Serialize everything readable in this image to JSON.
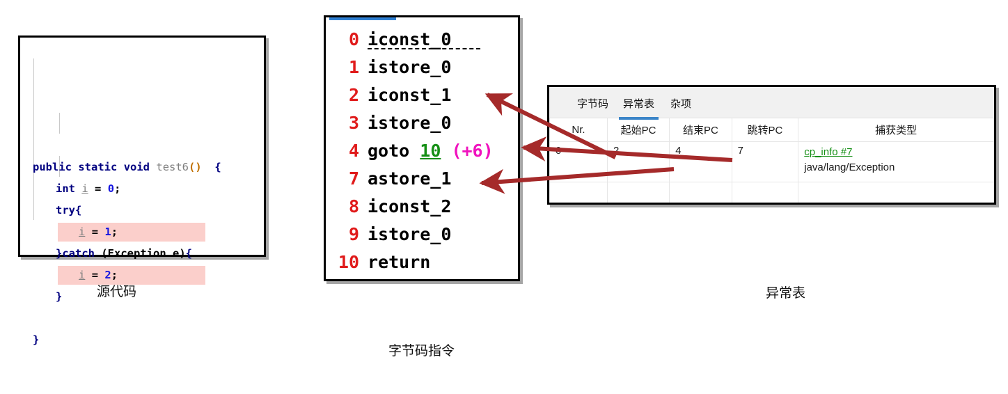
{
  "source_panel": {
    "title": "source-code",
    "lines": [
      {
        "indent": 0,
        "highlight": false,
        "tokens": [
          {
            "t": "public",
            "c": "k"
          },
          {
            "t": " ",
            "c": "plain"
          },
          {
            "t": "static",
            "c": "k"
          },
          {
            "t": " ",
            "c": "plain"
          },
          {
            "t": "void",
            "c": "k"
          },
          {
            "t": " ",
            "c": "plain"
          },
          {
            "t": "test6",
            "c": "mth"
          },
          {
            "t": "()",
            "c": "par"
          },
          {
            "t": "  ",
            "c": "plain"
          },
          {
            "t": "{",
            "c": "brc"
          }
        ]
      },
      {
        "indent": 1,
        "highlight": false,
        "tokens": [
          {
            "t": "int",
            "c": "k"
          },
          {
            "t": " ",
            "c": "plain"
          },
          {
            "t": "i",
            "c": "var"
          },
          {
            "t": " ",
            "c": "plain"
          },
          {
            "t": "=",
            "c": "op"
          },
          {
            "t": " ",
            "c": "plain"
          },
          {
            "t": "0",
            "c": "num"
          },
          {
            "t": ";",
            "c": "op"
          }
        ]
      },
      {
        "indent": 1,
        "highlight": false,
        "tokens": [
          {
            "t": "try",
            "c": "k"
          },
          {
            "t": "{",
            "c": "brc"
          }
        ]
      },
      {
        "indent": 2,
        "highlight": true,
        "tokens": [
          {
            "t": "i",
            "c": "var"
          },
          {
            "t": " ",
            "c": "plain"
          },
          {
            "t": "=",
            "c": "op"
          },
          {
            "t": " ",
            "c": "plain"
          },
          {
            "t": "1",
            "c": "num"
          },
          {
            "t": ";",
            "c": "op"
          }
        ]
      },
      {
        "indent": 1,
        "highlight": false,
        "tokens": [
          {
            "t": "}",
            "c": "brc"
          },
          {
            "t": "catch",
            "c": "k"
          },
          {
            "t": " (Exception e)",
            "c": "plain"
          },
          {
            "t": "{",
            "c": "brc"
          }
        ]
      },
      {
        "indent": 2,
        "highlight": true,
        "tokens": [
          {
            "t": "i",
            "c": "var"
          },
          {
            "t": " ",
            "c": "plain"
          },
          {
            "t": "=",
            "c": "op"
          },
          {
            "t": " ",
            "c": "plain"
          },
          {
            "t": "2",
            "c": "num"
          },
          {
            "t": ";",
            "c": "op"
          }
        ]
      },
      {
        "indent": 1,
        "highlight": false,
        "tokens": [
          {
            "t": "}",
            "c": "brc"
          }
        ]
      },
      {
        "indent": 0,
        "highlight": false,
        "tokens": []
      },
      {
        "indent": 0,
        "highlight": false,
        "tokens": [
          {
            "t": "}",
            "c": "brc"
          }
        ]
      }
    ],
    "highlight_color": "#fbcfcb"
  },
  "bytecode_panel": {
    "instructions": [
      {
        "index": "0",
        "op": "iconst_0",
        "dashed_underline": true
      },
      {
        "index": "1",
        "op": "istore_0",
        "dashed_underline": false
      },
      {
        "index": "2",
        "op": "iconst_1",
        "dashed_underline": false
      },
      {
        "index": "3",
        "op": "istore_0",
        "dashed_underline": false
      },
      {
        "index": "4",
        "op": "goto",
        "target": "10",
        "offset": "(+6)",
        "dashed_underline": false
      },
      {
        "index": "7",
        "op": "astore_1",
        "dashed_underline": false
      },
      {
        "index": "8",
        "op": "iconst_2",
        "dashed_underline": false
      },
      {
        "index": "9",
        "op": "istore_0",
        "dashed_underline": false
      },
      {
        "index": "10",
        "op": "return",
        "dashed_underline": false
      }
    ],
    "index_color": "#e01b1b",
    "target_color": "#158f15",
    "offset_color": "#f012be",
    "tab_indicator_color": "#2f7fd1"
  },
  "exception_panel": {
    "tabs": [
      {
        "label": "字节码",
        "active": false
      },
      {
        "label": "异常表",
        "active": true
      },
      {
        "label": "杂项",
        "active": false
      }
    ],
    "columns": [
      "Nr.",
      "起始PC",
      "结束PC",
      "跳转PC",
      "捕获类型"
    ],
    "rows": [
      {
        "nr": "0",
        "start_pc": "2",
        "end_pc": "4",
        "handler_pc": "7",
        "catch_link": "cp_info #7",
        "catch_type": "java/lang/Exception"
      }
    ],
    "active_tab_underline_color": "#3b85c8",
    "link_color": "#158f15"
  },
  "captions": {
    "source": "源代码",
    "bytecode": "字节码指令",
    "exception": "异常表"
  },
  "arrows": {
    "color": "#a52a2a",
    "items": [
      {
        "name": "arrow-start-pc-to-iconst1",
        "from_label": "2",
        "to_label": "2 iconst_1"
      },
      {
        "name": "arrow-end-pc-to-goto",
        "from_label": "4",
        "to_label": "4 goto 10"
      },
      {
        "name": "arrow-handler-pc-to-astore1",
        "from_label": "7",
        "to_label": "7 astore_1"
      }
    ]
  }
}
